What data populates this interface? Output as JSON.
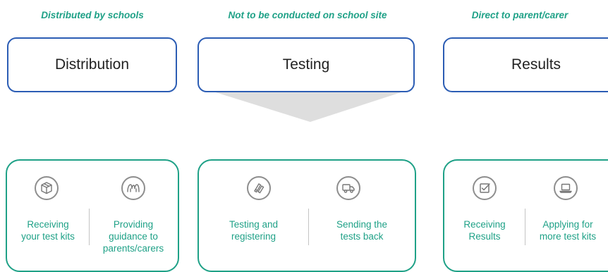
{
  "columns": [
    {
      "caption": "Distributed by schools",
      "stage": "Distribution",
      "items": [
        {
          "label": "Receiving\nyour test kits",
          "icon": "package-icon"
        },
        {
          "label": "Providing\nguidance to\nparents/carers",
          "icon": "guidance-icon"
        }
      ]
    },
    {
      "caption": "Not to be conducted on school site",
      "stage": "Testing",
      "items": [
        {
          "label": "Testing and\nregistering",
          "icon": "test-tubes-icon"
        },
        {
          "label": "Sending the\ntests back",
          "icon": "delivery-truck-icon"
        }
      ]
    },
    {
      "caption": "Direct to parent/carer",
      "stage": "Results",
      "items": [
        {
          "label": "Receiving\nResults",
          "icon": "checkbox-icon"
        },
        {
          "label": "Applying for\nmore test kits",
          "icon": "laptop-icon"
        }
      ]
    }
  ],
  "colors": {
    "caption": "#1fa187",
    "stage_border": "#2c5db4",
    "card_border": "#1fa187",
    "pointer": "#dedede"
  }
}
